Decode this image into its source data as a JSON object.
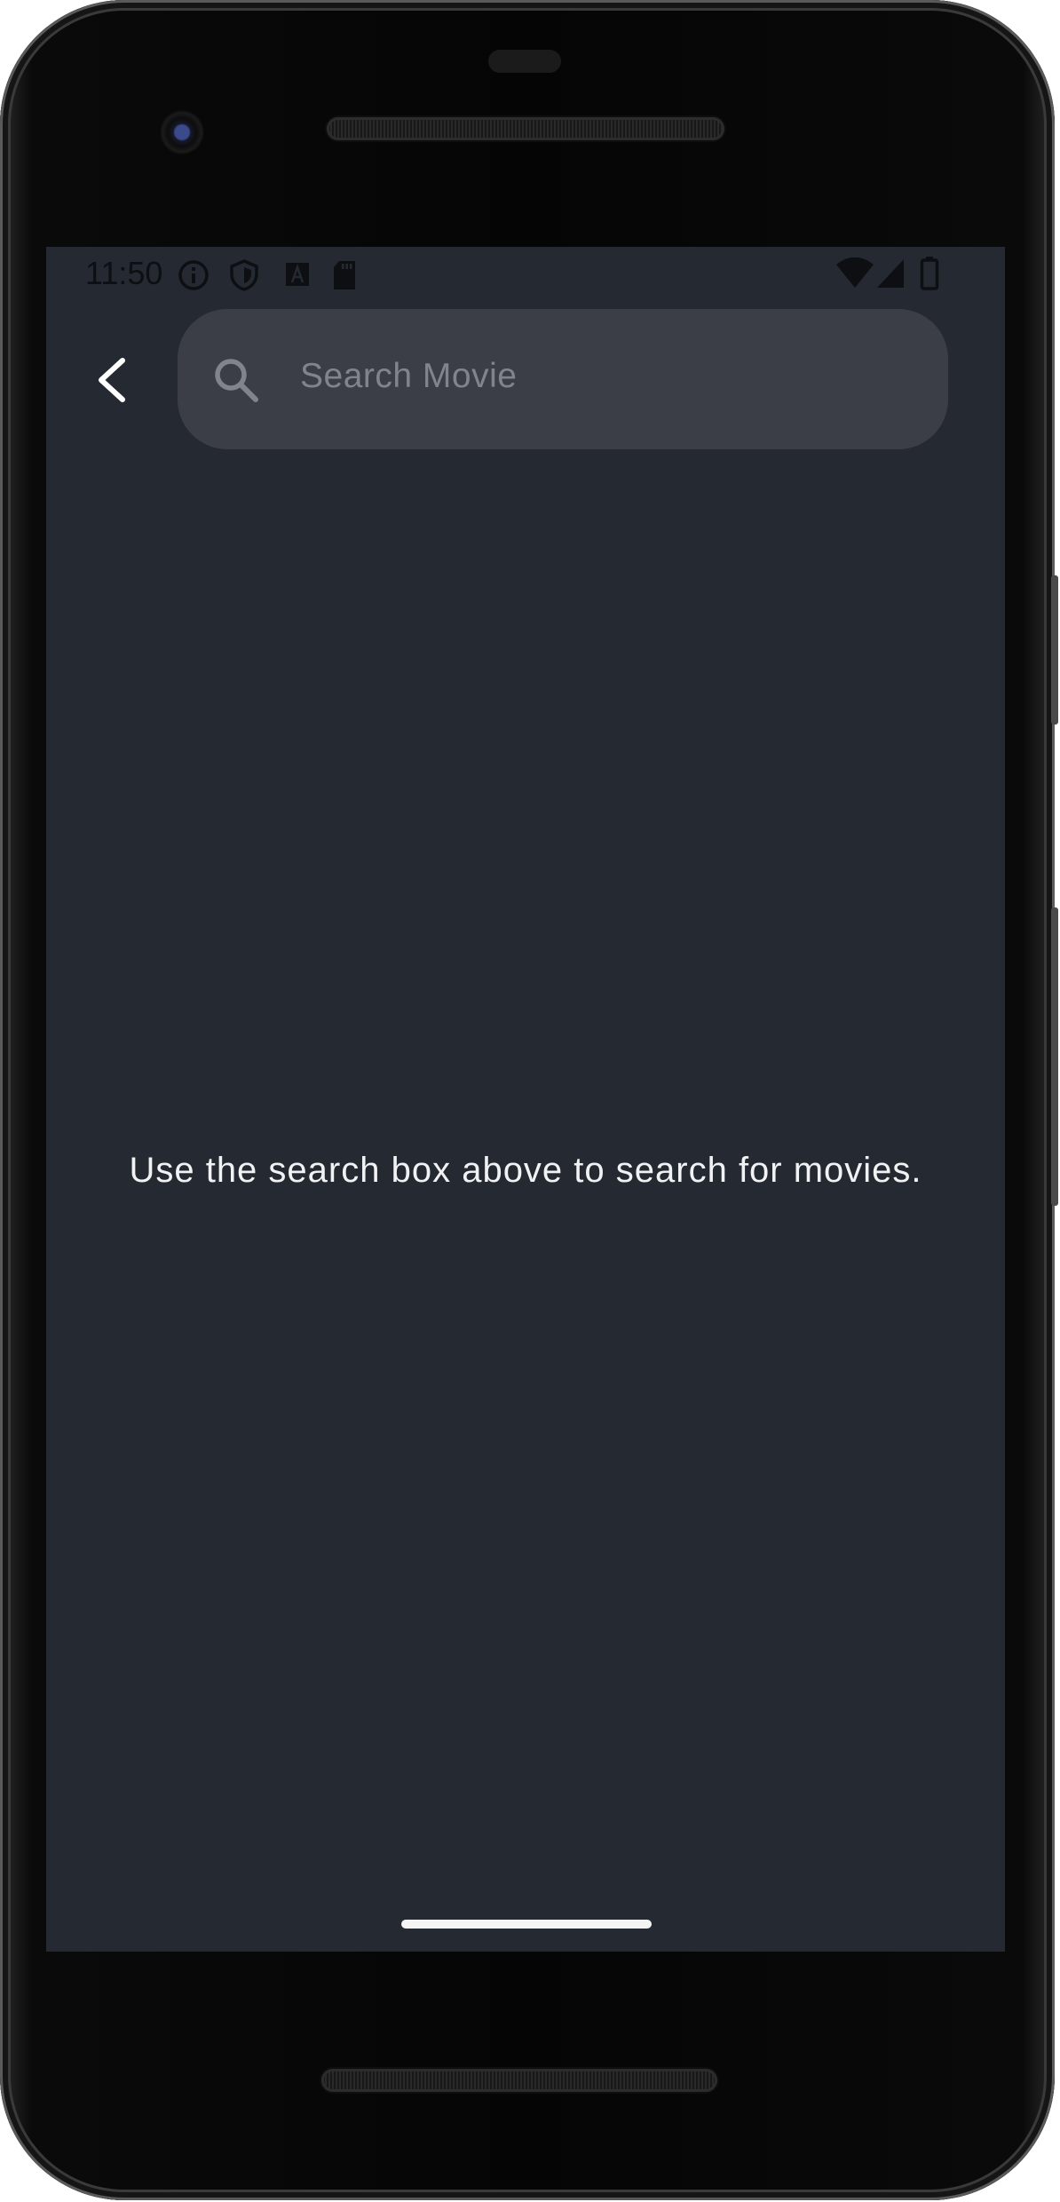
{
  "status_bar": {
    "time": "11:50",
    "left_icons": [
      "info-icon",
      "shield-icon",
      "a-badge-icon",
      "sd-card-icon"
    ],
    "right_icons": [
      "wifi-icon",
      "signal-icon",
      "battery-icon"
    ]
  },
  "search": {
    "placeholder": "Search Movie",
    "value": ""
  },
  "main": {
    "empty_message": "Use the search box above to search for movies."
  },
  "colors": {
    "screen_background": "#252a32",
    "search_field": "#3b3e46",
    "text_primary": "#f1f2f4",
    "placeholder": "#80848c"
  }
}
